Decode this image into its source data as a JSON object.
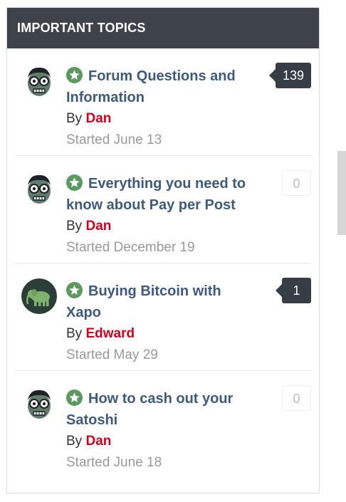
{
  "widget": {
    "title": "IMPORTANT TOPICS"
  },
  "topics": [
    {
      "title_line1": "Forum Questions and",
      "title_line2": "Information",
      "by_prefix": "By",
      "author": "Dan",
      "started": "Started June 13",
      "replies": "139",
      "avatar": "zombie-avatar"
    },
    {
      "title_line1": "Everything you need to",
      "title_line2": "know about Pay per Post",
      "by_prefix": "By",
      "author": "Dan",
      "started": "Started December 19",
      "replies": "0",
      "avatar": "zombie-avatar"
    },
    {
      "title_line1": "Buying Bitcoin with",
      "title_line2": "Xapo",
      "by_prefix": "By",
      "author": "Edward",
      "started": "Started May 29",
      "replies": "1",
      "avatar": "elephant-avatar"
    },
    {
      "title_line1": "How to cash out your",
      "title_line2": "Satoshi",
      "by_prefix": "By",
      "author": "Dan",
      "started": "Started June 18",
      "replies": "0",
      "avatar": "zombie-avatar"
    }
  ],
  "colors": {
    "header_bg": "#3d4349",
    "title_link": "#3d5a80",
    "author": "#d0021b",
    "pinned_star": "#5a9a5e",
    "count_active": "#373d44"
  },
  "icons": {
    "pinned": "star-icon"
  }
}
